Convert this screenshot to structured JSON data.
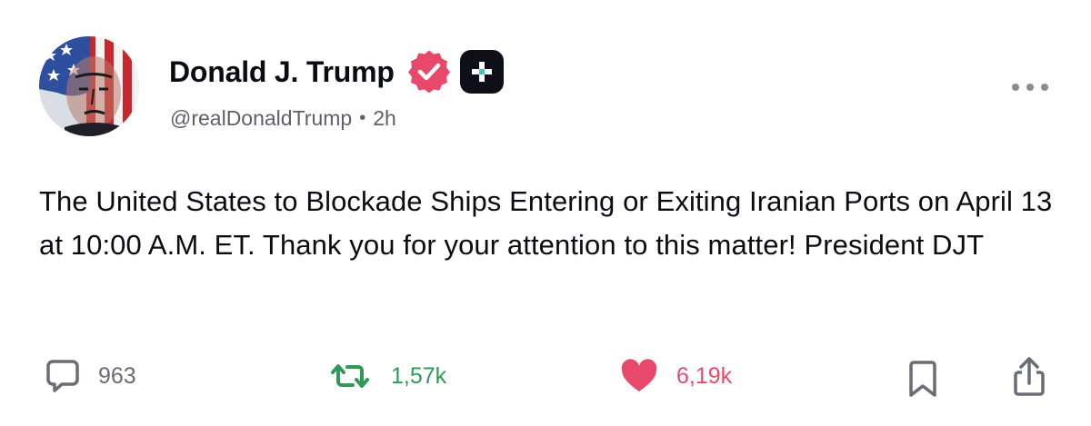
{
  "author": {
    "display_name": "Donald J. Trump",
    "handle": "@realDonaldTrump",
    "separator": "•",
    "time_ago": "2h"
  },
  "post": {
    "text": "The United States to Blockade Ships Entering or Exiting Iranian Ports on April 13 at 10:00 A.M. ET. Thank you for your attention to this matter! President DJT"
  },
  "actions": {
    "replies": "963",
    "reposts": "1,57k",
    "likes": "6,19k"
  },
  "colors": {
    "verified": "#e8496b",
    "repost": "#2f9a57",
    "like": "#e8496b",
    "muted": "#6b6b76"
  },
  "icons": [
    "verified-badge-icon",
    "plus-badge-icon",
    "more-options-icon",
    "reply-icon",
    "repost-icon",
    "heart-icon",
    "bookmark-icon",
    "share-icon"
  ]
}
